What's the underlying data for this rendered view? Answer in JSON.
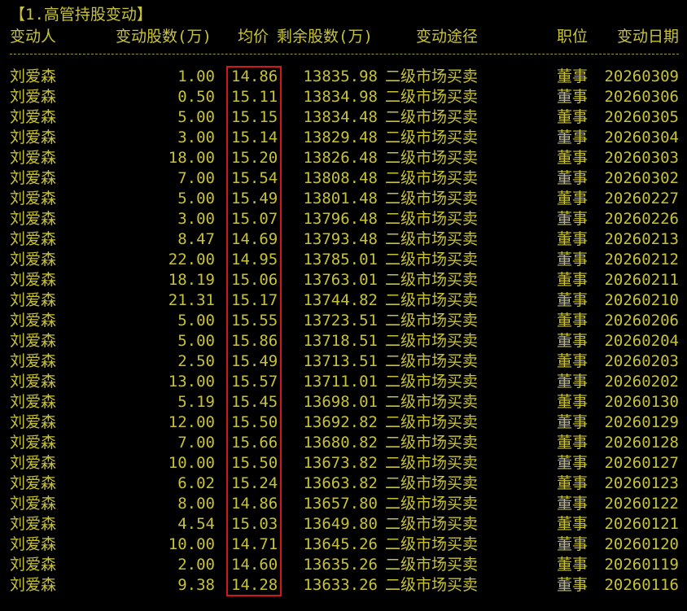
{
  "title": "【1.高管持股变动】",
  "headers": {
    "name": "变动人",
    "shares": "变动股数(万)",
    "price": "均价",
    "remain": "剩余股数(万)",
    "route": "变动途径",
    "position": "职位",
    "date": "变动日期"
  },
  "colors": {
    "background": "#000000",
    "text": "#c8c238",
    "highlight_border": "#d21818"
  },
  "rows": [
    {
      "name": "刘爱森",
      "shares": "1.00",
      "price": "14.86",
      "remain": "13835.98",
      "route": "二级市场买卖",
      "position": "董事",
      "date": "20260309"
    },
    {
      "name": "刘爱森",
      "shares": "0.50",
      "price": "15.11",
      "remain": "13834.98",
      "route": "二级市场买卖",
      "position": "董事",
      "date": "20260306"
    },
    {
      "name": "刘爱森",
      "shares": "5.00",
      "price": "15.15",
      "remain": "13834.48",
      "route": "二级市场买卖",
      "position": "董事",
      "date": "20260305"
    },
    {
      "name": "刘爱森",
      "shares": "3.00",
      "price": "15.14",
      "remain": "13829.48",
      "route": "二级市场买卖",
      "position": "董事",
      "date": "20260304"
    },
    {
      "name": "刘爱森",
      "shares": "18.00",
      "price": "15.20",
      "remain": "13826.48",
      "route": "二级市场买卖",
      "position": "董事",
      "date": "20260303"
    },
    {
      "name": "刘爱森",
      "shares": "7.00",
      "price": "15.54",
      "remain": "13808.48",
      "route": "二级市场买卖",
      "position": "董事",
      "date": "20260302"
    },
    {
      "name": "刘爱森",
      "shares": "5.00",
      "price": "15.49",
      "remain": "13801.48",
      "route": "二级市场买卖",
      "position": "董事",
      "date": "20260227"
    },
    {
      "name": "刘爱森",
      "shares": "3.00",
      "price": "15.07",
      "remain": "13796.48",
      "route": "二级市场买卖",
      "position": "董事",
      "date": "20260226"
    },
    {
      "name": "刘爱森",
      "shares": "8.47",
      "price": "14.69",
      "remain": "13793.48",
      "route": "二级市场买卖",
      "position": "董事",
      "date": "20260213"
    },
    {
      "name": "刘爱森",
      "shares": "22.00",
      "price": "14.95",
      "remain": "13785.01",
      "route": "二级市场买卖",
      "position": "董事",
      "date": "20260212"
    },
    {
      "name": "刘爱森",
      "shares": "18.19",
      "price": "15.06",
      "remain": "13763.01",
      "route": "二级市场买卖",
      "position": "董事",
      "date": "20260211"
    },
    {
      "name": "刘爱森",
      "shares": "21.31",
      "price": "15.17",
      "remain": "13744.82",
      "route": "二级市场买卖",
      "position": "董事",
      "date": "20260210"
    },
    {
      "name": "刘爱森",
      "shares": "5.00",
      "price": "15.55",
      "remain": "13723.51",
      "route": "二级市场买卖",
      "position": "董事",
      "date": "20260206"
    },
    {
      "name": "刘爱森",
      "shares": "5.00",
      "price": "15.86",
      "remain": "13718.51",
      "route": "二级市场买卖",
      "position": "董事",
      "date": "20260204"
    },
    {
      "name": "刘爱森",
      "shares": "2.50",
      "price": "15.49",
      "remain": "13713.51",
      "route": "二级市场买卖",
      "position": "董事",
      "date": "20260203"
    },
    {
      "name": "刘爱森",
      "shares": "13.00",
      "price": "15.57",
      "remain": "13711.01",
      "route": "二级市场买卖",
      "position": "董事",
      "date": "20260202"
    },
    {
      "name": "刘爱森",
      "shares": "5.19",
      "price": "15.45",
      "remain": "13698.01",
      "route": "二级市场买卖",
      "position": "董事",
      "date": "20260130"
    },
    {
      "name": "刘爱森",
      "shares": "12.00",
      "price": "15.50",
      "remain": "13692.82",
      "route": "二级市场买卖",
      "position": "董事",
      "date": "20260129"
    },
    {
      "name": "刘爱森",
      "shares": "7.00",
      "price": "15.66",
      "remain": "13680.82",
      "route": "二级市场买卖",
      "position": "董事",
      "date": "20260128"
    },
    {
      "name": "刘爱森",
      "shares": "10.00",
      "price": "15.50",
      "remain": "13673.82",
      "route": "二级市场买卖",
      "position": "董事",
      "date": "20260127"
    },
    {
      "name": "刘爱森",
      "shares": "6.02",
      "price": "15.24",
      "remain": "13663.82",
      "route": "二级市场买卖",
      "position": "董事",
      "date": "20260123"
    },
    {
      "name": "刘爱森",
      "shares": "8.00",
      "price": "14.86",
      "remain": "13657.80",
      "route": "二级市场买卖",
      "position": "董事",
      "date": "20260122"
    },
    {
      "name": "刘爱森",
      "shares": "4.54",
      "price": "15.03",
      "remain": "13649.80",
      "route": "二级市场买卖",
      "position": "董事",
      "date": "20260121"
    },
    {
      "name": "刘爱森",
      "shares": "10.00",
      "price": "14.71",
      "remain": "13645.26",
      "route": "二级市场买卖",
      "position": "董事",
      "date": "20260120"
    },
    {
      "name": "刘爱森",
      "shares": "2.00",
      "price": "14.60",
      "remain": "13635.26",
      "route": "二级市场买卖",
      "position": "董事",
      "date": "20260119"
    },
    {
      "name": "刘爱森",
      "shares": "9.38",
      "price": "14.28",
      "remain": "13633.26",
      "route": "二级市场买卖",
      "position": "董事",
      "date": "20260116"
    }
  ]
}
